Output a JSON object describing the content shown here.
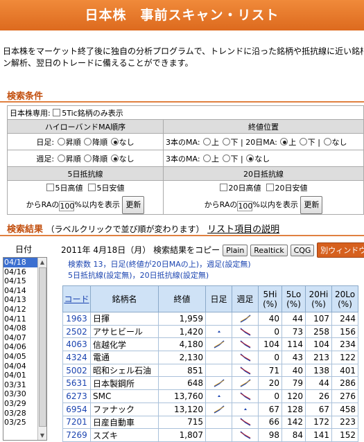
{
  "page": {
    "title": "日本株　事前スキャン・リスト",
    "intro_lines": [
      "日本株をマーケット終了後に独自の分析プログラムで、トレンドに沿った銘柄や抵抗線に近い銘柄",
      "ン解析、翌日のトレードに備えることができます。"
    ]
  },
  "search": {
    "section_title": "検索条件",
    "japan_only_label": "日本株専用:",
    "tic_only_label": "5Tic銘柄のみ表示",
    "highlow_header": "ハイローバンドMA順序",
    "close_header": "終値位置",
    "daily_label": "日足:",
    "weekly_label": "週足:",
    "up_label": "昇順",
    "down_label": "降順",
    "none_label": "なし",
    "ma3_label": "3本のMA:",
    "above_label": "上",
    "below_label": "下",
    "ma20_label": "20日MA:",
    "sep": "|",
    "resist5_header": "5日抵抗線",
    "resist20_header": "20日抵抗線",
    "high5_label": "5日高値",
    "low5_label": "5日安値",
    "high20_label": "20日高値",
    "low20_label": "20日安値",
    "ra_prefix": "からRAの",
    "ra_value": "100",
    "ra_suffix": "%以内を表示",
    "update_label": "更新"
  },
  "results": {
    "section_title": "検索結果",
    "section_sub": "（ラベルクリックで並び順が変わります）",
    "explain_link": "リスト項目の説明",
    "date_label": "日付",
    "dates": [
      "04/18",
      "04/16",
      "04/15",
      "04/14",
      "04/13",
      "04/12",
      "04/11",
      "04/08",
      "04/07",
      "04/06",
      "04/05",
      "04/04",
      "04/01",
      "03/31",
      "03/30",
      "03/29",
      "03/28",
      "03/25"
    ],
    "current_date": "2011年 4月18日（月）",
    "copy_label": "検索結果をコピー",
    "plain_btn": "Plain",
    "realtick_btn": "Realtick",
    "cqg_btn": "CQG",
    "newwin_btn": "別ウィンドウ表",
    "info_line1": "検索数 13，日足(終値が20日MAの上)，週足(設定無)",
    "info_line2": "5日抵抗線(設定無)，20日抵抗線(設定無)",
    "columns": {
      "code": "コード",
      "name": "銘柄名",
      "close": "終値",
      "daily": "日足",
      "weekly": "週足",
      "hi5": "5Hi",
      "lo5": "5Lo",
      "hi20": "20Hi",
      "lo20": "20Lo",
      "pct": "(%)"
    },
    "rows": [
      {
        "code": "1963",
        "name": "日揮",
        "close": "1,959",
        "d": "none",
        "w": "up",
        "hi5": "40",
        "lo5": "44",
        "hi20": "107",
        "lo20": "244"
      },
      {
        "code": "2502",
        "name": "アサヒビール",
        "close": "1,420",
        "d": "tri",
        "w": "down",
        "hi5": "0",
        "lo5": "73",
        "hi20": "258",
        "lo20": "156"
      },
      {
        "code": "4063",
        "name": "信越化学",
        "close": "4,180",
        "d": "up",
        "w": "down",
        "hi5": "104",
        "lo5": "114",
        "hi20": "104",
        "lo20": "234"
      },
      {
        "code": "4324",
        "name": "電通",
        "close": "2,130",
        "d": "none",
        "w": "down",
        "hi5": "0",
        "lo5": "43",
        "hi20": "213",
        "lo20": "122"
      },
      {
        "code": "5002",
        "name": "昭和シェル石油",
        "close": "851",
        "d": "none",
        "w": "down",
        "hi5": "71",
        "lo5": "40",
        "hi20": "138",
        "lo20": "401"
      },
      {
        "code": "5631",
        "name": "日本製鋼所",
        "close": "648",
        "d": "up",
        "w": "up",
        "hi5": "20",
        "lo5": "79",
        "hi20": "44",
        "lo20": "286"
      },
      {
        "code": "6273",
        "name": "SMC",
        "close": "13,760",
        "d": "tri",
        "w": "down",
        "hi5": "0",
        "lo5": "120",
        "hi20": "26",
        "lo20": "276"
      },
      {
        "code": "6954",
        "name": "ファナック",
        "close": "13,120",
        "d": "up",
        "w": "tri",
        "hi5": "67",
        "lo5": "128",
        "hi20": "67",
        "lo20": "458"
      },
      {
        "code": "7201",
        "name": "日産自動車",
        "close": "715",
        "d": "none",
        "w": "down",
        "hi5": "66",
        "lo5": "142",
        "hi20": "172",
        "lo20": "223"
      },
      {
        "code": "7269",
        "name": "スズキ",
        "close": "1,807",
        "d": "none",
        "w": "down",
        "hi5": "98",
        "lo5": "84",
        "hi20": "141",
        "lo20": "152"
      }
    ]
  },
  "colors": {
    "accent": "#dd6a1e",
    "link": "#1b44b0",
    "header_bg": "#cfe2f6"
  }
}
